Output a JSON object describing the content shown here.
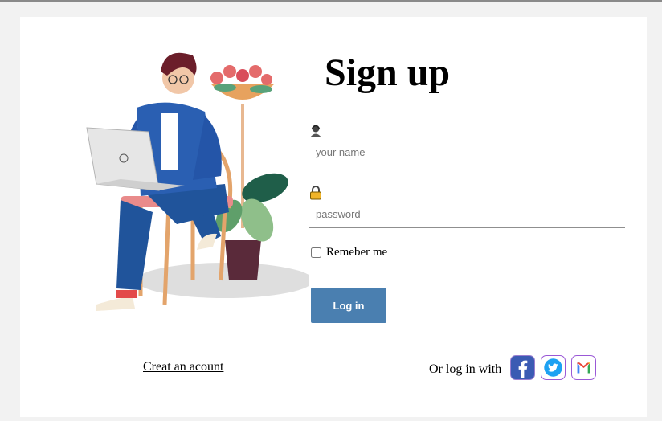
{
  "form": {
    "title": "Sign up",
    "name_placeholder": "your name",
    "password_placeholder": "password",
    "remember_label": "Remeber me",
    "login_label": "Log in"
  },
  "footer": {
    "create_account_label": "Creat an acount",
    "social_text": "Or log in with",
    "social_icons": [
      "facebook-icon",
      "twitter-icon",
      "gmail-icon"
    ]
  },
  "colors": {
    "button": "#4a7fb0",
    "facebook": "#3b5bb3",
    "twitter": "#1da1f2",
    "page_bg": "#f2f2f2"
  }
}
